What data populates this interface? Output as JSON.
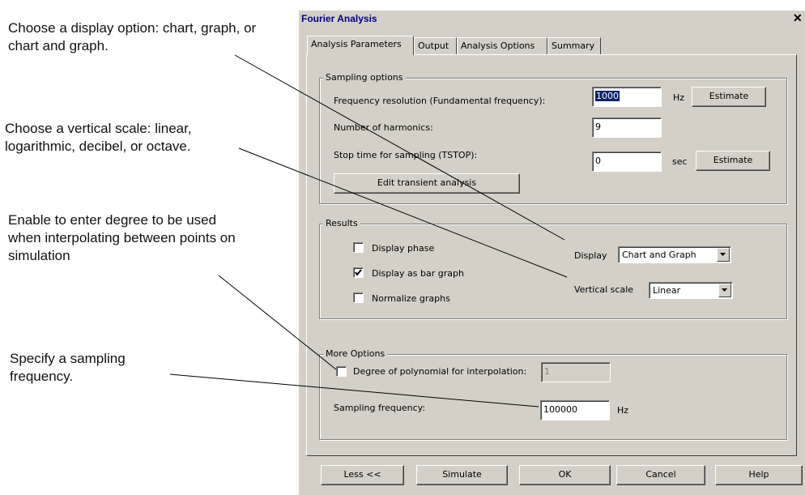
{
  "callouts": {
    "display": "Choose a display option: chart, graph, or chart and graph.",
    "vscale": "Choose a vertical scale: linear, logarithmic, decibel, or octave.",
    "degree": "Enable to enter degree to be used when interpolating between points on simulation",
    "sampling": "Specify a sampling frequency."
  },
  "dialog": {
    "title": "Fourier Analysis",
    "close_icon": "close-icon",
    "tabs": [
      "Analysis Parameters",
      "Output",
      "Analysis Options",
      "Summary"
    ],
    "sampling_options": {
      "legend": "Sampling options",
      "freq_label": "Frequency resolution (Fundamental frequency):",
      "freq_value": "1000",
      "freq_unit": "Hz",
      "harmonics_label": "Number of harmonics:",
      "harmonics_value": "9",
      "tstop_label": "Stop time for sampling (TSTOP):",
      "tstop_value": "0",
      "tstop_unit": "sec",
      "estimate_label": "Estimate",
      "edit_transient_label": "Edit transient analysis"
    },
    "results": {
      "legend": "Results",
      "display_phase": "Display phase",
      "display_phase_checked": false,
      "bar_graph": "Display as bar graph",
      "bar_graph_checked": true,
      "normalize": "Normalize graphs",
      "normalize_checked": false,
      "display_label": "Display",
      "display_value": "Chart and Graph",
      "vscale_label": "Vertical scale",
      "vscale_value": "Linear"
    },
    "more_options": {
      "legend": "More Options",
      "degree_label": "Degree of polynomial for interpolation:",
      "degree_checked": false,
      "degree_value": "1",
      "sampling_label": "Sampling frequency:",
      "sampling_value": "100000",
      "sampling_unit": "Hz"
    },
    "buttons": {
      "less": "Less <<",
      "simulate": "Simulate",
      "ok": "OK",
      "cancel": "Cancel",
      "help": "Help"
    }
  }
}
